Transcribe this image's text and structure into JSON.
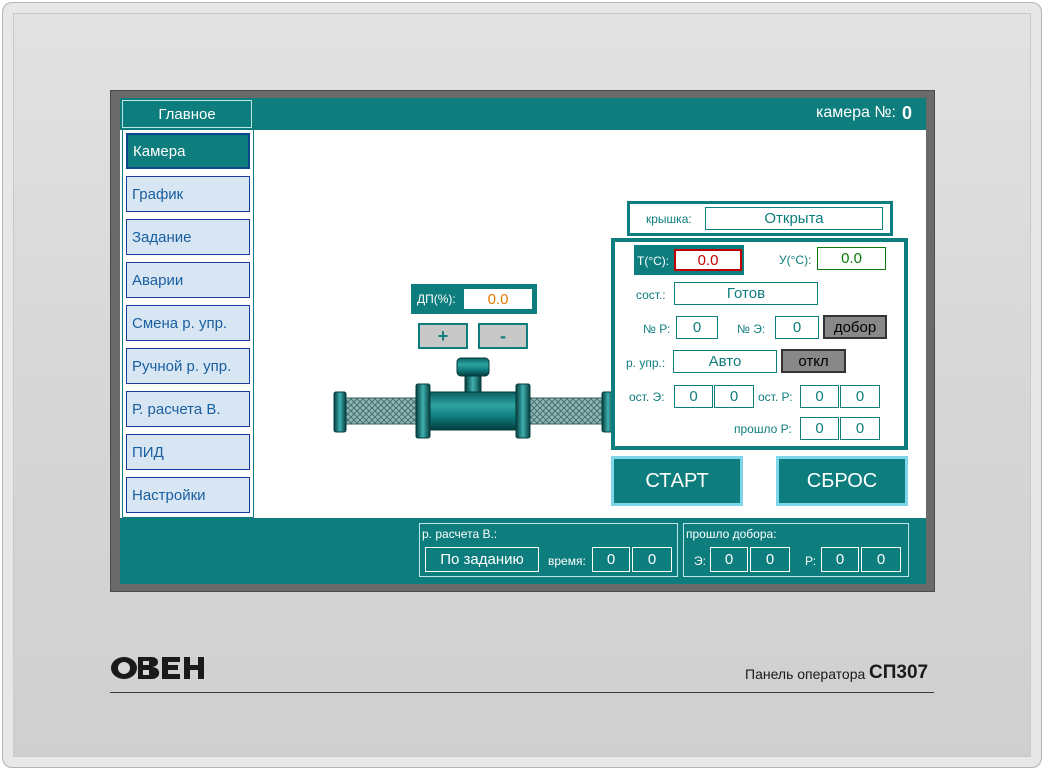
{
  "header": {
    "main_tab": "Главное",
    "camera_label": "камера №:",
    "camera_number": "0"
  },
  "sidebar": {
    "items": [
      {
        "label": "Камера",
        "active": true
      },
      {
        "label": "График"
      },
      {
        "label": "Задание"
      },
      {
        "label": "Аварии"
      },
      {
        "label": "Смена р. упр."
      },
      {
        "label": "Ручной р. упр."
      },
      {
        "label": "Р. расчета В."
      },
      {
        "label": "ПИД"
      },
      {
        "label": "Настройки"
      }
    ]
  },
  "valve": {
    "dp_label": "ДП(%):",
    "dp_value": "0.0",
    "plus_label": "+",
    "minus_label": "-"
  },
  "lid": {
    "label": "крышка:",
    "value": "Открыта"
  },
  "panel": {
    "t_label": "Т(°С):",
    "t_value": "0.0",
    "u_label": "У(°С):",
    "u_value": "0.0",
    "state_label": "сост.:",
    "state_value": "Готов",
    "nr_label": "№ Р:",
    "nr_value": "0",
    "ne_label": "№ Э:",
    "ne_value": "0",
    "dobor_label": "добор",
    "mode_label": "р. упр.:",
    "mode_value": "Авто",
    "off_label": "откл",
    "rem_e_label": "ост. Э:",
    "rem_e_1": "0",
    "rem_e_2": "0",
    "rem_r_label": "ост. Р:",
    "rem_r_1": "0",
    "rem_r_2": "0",
    "passed_r_label": "прошло Р:",
    "passed_r_1": "0",
    "passed_r_2": "0"
  },
  "buttons": {
    "start": "СТАРТ",
    "reset": "СБРОС"
  },
  "bottom": {
    "calc_label": "р. расчета В.:",
    "calc_value": "По заданию",
    "time_label": "время:",
    "time_1": "0",
    "time_2": "0",
    "passed_label": "прошло добора:",
    "e_label": "Э:",
    "e_1": "0",
    "e_2": "0",
    "r_label": "Р:",
    "r_1": "0",
    "r_2": "0"
  },
  "footer": {
    "brand": "ОВЕН",
    "panel_name": "Панель оператора",
    "panel_model": "СП307"
  },
  "colors": {
    "accent": "#0e7d7d",
    "button_blue_border": "#1a3c9c",
    "sidebar_button_bg": "#d8e6f3",
    "t_value_color": "#c00000",
    "dp_value_color": "#e07a00",
    "u_value_color": "#0a7a0a"
  },
  "icons": [
    "plus-icon",
    "minus-icon",
    "valve-pipe-drawing",
    "oven-logo"
  ]
}
